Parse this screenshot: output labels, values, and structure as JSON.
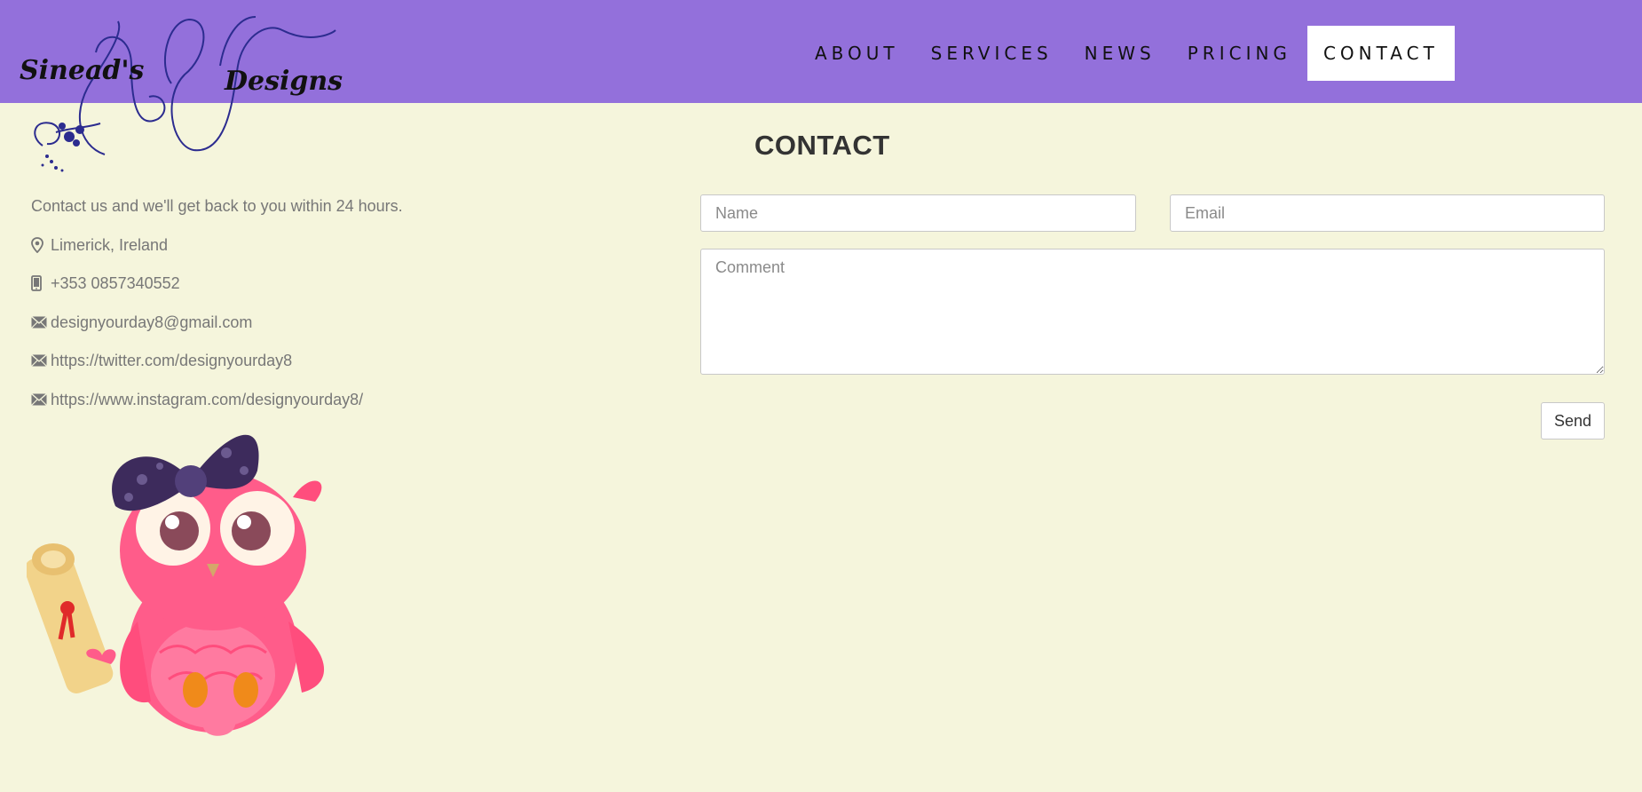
{
  "brand": {
    "name_part1": "Sinead's",
    "name_part2": "Designs",
    "logo_color": "#2c2c8f"
  },
  "nav": {
    "background": "#9370db",
    "items": [
      {
        "label": "ABOUT",
        "active": false
      },
      {
        "label": "SERVICES",
        "active": false
      },
      {
        "label": "NEWS",
        "active": false
      },
      {
        "label": "PRICING",
        "active": false
      },
      {
        "label": "CONTACT",
        "active": true
      }
    ]
  },
  "page": {
    "title": "CONTACT",
    "background": "#f5f5dc"
  },
  "contact_info": {
    "intro": "Contact us and we'll get back to you within 24 hours.",
    "location": "Limerick, Ireland",
    "phone": "+353 0857340552",
    "email": "designyourday8@gmail.com",
    "twitter": "https://twitter.com/designyourday8",
    "instagram": "https://www.instagram.com/designyourday8/",
    "icons": [
      "map-marker-icon",
      "phone-icon",
      "envelope-icon",
      "envelope-icon",
      "envelope-icon"
    ]
  },
  "form": {
    "name_placeholder": "Name",
    "email_placeholder": "Email",
    "comment_placeholder": "Comment",
    "name_value": "",
    "email_value": "",
    "comment_value": "",
    "send_label": "Send"
  },
  "illustration": {
    "subject": "pink-owl-with-scroll",
    "colors": {
      "body": "#ff5c8a",
      "bow": "#3d2b5c",
      "scroll": "#f2d38a"
    }
  }
}
